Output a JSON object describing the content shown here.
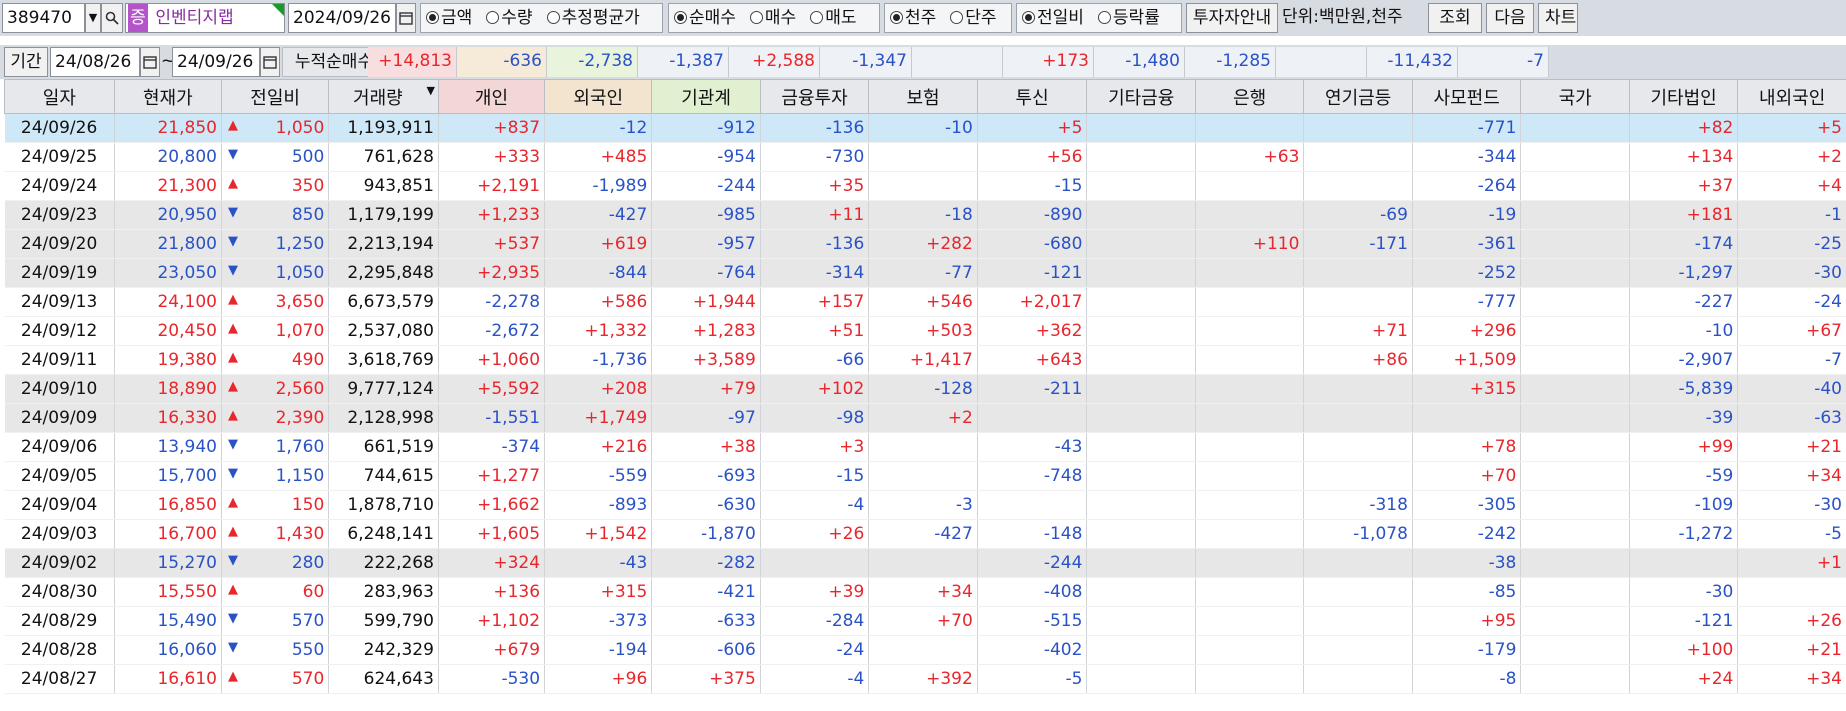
{
  "toolbar": {
    "code": "389470",
    "name_badge": "증",
    "name": "인벤티지랩",
    "date": "2024/09/26",
    "unit_type": [
      "금액",
      "수량",
      "추정평균가"
    ],
    "unit_type_selected": 0,
    "trade_type": [
      "순매수",
      "매수",
      "매도"
    ],
    "trade_type_selected": 0,
    "share_unit": [
      "천주",
      "단주"
    ],
    "share_unit_selected": 0,
    "compare": [
      "전일비",
      "등락률"
    ],
    "compare_selected": 0,
    "guide_button": "투자자안내",
    "unit_label": "단위:백만원,천주",
    "query_button": "조회",
    "next_button": "다음",
    "chart_button": "차트"
  },
  "period": {
    "label": "기간",
    "from": "24/08/26",
    "tilde": "~",
    "to": "24/09/26",
    "cum_label": "누적순매수",
    "totals": [
      "+14,813",
      "-636",
      "-2,738",
      "-1,387",
      "+2,588",
      "-1,347",
      "",
      "+173",
      "-1,480",
      "-1,285",
      "",
      "-11,432",
      "-7"
    ]
  },
  "headers": [
    "일자",
    "현재가",
    "전일비",
    "거래량",
    "개인",
    "외국인",
    "기관계",
    "금융투자",
    "보험",
    "투신",
    "기타금융",
    "은행",
    "연기금등",
    "사모펀드",
    "국가",
    "기타법인",
    "내외국인"
  ],
  "rows": [
    {
      "d": "24/09/26",
      "p": "21,850",
      "dir": "up",
      "ch": "1,050",
      "v": "1,193,911",
      "c": [
        "+837",
        "-12",
        "-912",
        "-136",
        "-10",
        "+5",
        "",
        "",
        "",
        "-771",
        "",
        "+82",
        "+5"
      ]
    },
    {
      "d": "24/09/25",
      "p": "20,800",
      "dir": "down",
      "ch": "500",
      "v": "761,628",
      "c": [
        "+333",
        "+485",
        "-954",
        "-730",
        "",
        "+56",
        "",
        "+63",
        "",
        "-344",
        "",
        "+134",
        "+2"
      ]
    },
    {
      "d": "24/09/24",
      "p": "21,300",
      "dir": "up",
      "ch": "350",
      "v": "943,851",
      "c": [
        "+2,191",
        "-1,989",
        "-244",
        "+35",
        "",
        "-15",
        "",
        "",
        "",
        "-264",
        "",
        "+37",
        "+4"
      ]
    },
    {
      "d": "24/09/23",
      "p": "20,950",
      "dir": "down",
      "ch": "850",
      "v": "1,179,199",
      "c": [
        "+1,233",
        "-427",
        "-985",
        "+11",
        "-18",
        "-890",
        "",
        "",
        "-69",
        "-19",
        "",
        "+181",
        "-1"
      ]
    },
    {
      "d": "24/09/20",
      "p": "21,800",
      "dir": "down",
      "ch": "1,250",
      "v": "2,213,194",
      "c": [
        "+537",
        "+619",
        "-957",
        "-136",
        "+282",
        "-680",
        "",
        "+110",
        "-171",
        "-361",
        "",
        "-174",
        "-25"
      ]
    },
    {
      "d": "24/09/19",
      "p": "23,050",
      "dir": "down",
      "ch": "1,050",
      "v": "2,295,848",
      "c": [
        "+2,935",
        "-844",
        "-764",
        "-314",
        "-77",
        "-121",
        "",
        "",
        "",
        "-252",
        "",
        "-1,297",
        "-30"
      ]
    },
    {
      "d": "24/09/13",
      "p": "24,100",
      "dir": "up",
      "ch": "3,650",
      "v": "6,673,579",
      "c": [
        "-2,278",
        "+586",
        "+1,944",
        "+157",
        "+546",
        "+2,017",
        "",
        "",
        "",
        "-777",
        "",
        "-227",
        "-24"
      ]
    },
    {
      "d": "24/09/12",
      "p": "20,450",
      "dir": "up",
      "ch": "1,070",
      "v": "2,537,080",
      "c": [
        "-2,672",
        "+1,332",
        "+1,283",
        "+51",
        "+503",
        "+362",
        "",
        "",
        "+71",
        "+296",
        "",
        "-10",
        "+67"
      ]
    },
    {
      "d": "24/09/11",
      "p": "19,380",
      "dir": "up",
      "ch": "490",
      "v": "3,618,769",
      "c": [
        "+1,060",
        "-1,736",
        "+3,589",
        "-66",
        "+1,417",
        "+643",
        "",
        "",
        "+86",
        "+1,509",
        "",
        "-2,907",
        "-7"
      ]
    },
    {
      "d": "24/09/10",
      "p": "18,890",
      "dir": "up",
      "ch": "2,560",
      "v": "9,777,124",
      "c": [
        "+5,592",
        "+208",
        "+79",
        "+102",
        "-128",
        "-211",
        "",
        "",
        "",
        "+315",
        "",
        "-5,839",
        "-40"
      ]
    },
    {
      "d": "24/09/09",
      "p": "16,330",
      "dir": "up",
      "ch": "2,390",
      "v": "2,128,998",
      "c": [
        "-1,551",
        "+1,749",
        "-97",
        "-98",
        "+2",
        "",
        "",
        "",
        "",
        "",
        "",
        "-39",
        "-63"
      ]
    },
    {
      "d": "24/09/06",
      "p": "13,940",
      "dir": "down",
      "ch": "1,760",
      "v": "661,519",
      "c": [
        "-374",
        "+216",
        "+38",
        "+3",
        "",
        "-43",
        "",
        "",
        "",
        "+78",
        "",
        "+99",
        "+21"
      ]
    },
    {
      "d": "24/09/05",
      "p": "15,700",
      "dir": "down",
      "ch": "1,150",
      "v": "744,615",
      "c": [
        "+1,277",
        "-559",
        "-693",
        "-15",
        "",
        "-748",
        "",
        "",
        "",
        "+70",
        "",
        "-59",
        "+34"
      ]
    },
    {
      "d": "24/09/04",
      "p": "16,850",
      "dir": "up",
      "ch": "150",
      "v": "1,878,710",
      "c": [
        "+1,662",
        "-893",
        "-630",
        "-4",
        "-3",
        "",
        "",
        "",
        "-318",
        "-305",
        "",
        "-109",
        "-30"
      ]
    },
    {
      "d": "24/09/03",
      "p": "16,700",
      "dir": "up",
      "ch": "1,430",
      "v": "6,248,141",
      "c": [
        "+1,605",
        "+1,542",
        "-1,870",
        "+26",
        "-427",
        "-148",
        "",
        "",
        "-1,078",
        "-242",
        "",
        "-1,272",
        "-5"
      ]
    },
    {
      "d": "24/09/02",
      "p": "15,270",
      "dir": "down",
      "ch": "280",
      "v": "222,268",
      "c": [
        "+324",
        "-43",
        "-282",
        "",
        "",
        "-244",
        "",
        "",
        "",
        "-38",
        "",
        "",
        "+1"
      ]
    },
    {
      "d": "24/08/30",
      "p": "15,550",
      "dir": "up",
      "ch": "60",
      "v": "283,963",
      "c": [
        "+136",
        "+315",
        "-421",
        "+39",
        "+34",
        "-408",
        "",
        "",
        "",
        "-85",
        "",
        "-30",
        ""
      ]
    },
    {
      "d": "24/08/29",
      "p": "15,490",
      "dir": "down",
      "ch": "570",
      "v": "599,790",
      "c": [
        "+1,102",
        "-373",
        "-633",
        "-284",
        "+70",
        "-515",
        "",
        "",
        "",
        "+95",
        "",
        "-121",
        "+26"
      ]
    },
    {
      "d": "24/08/28",
      "p": "16,060",
      "dir": "down",
      "ch": "550",
      "v": "242,329",
      "c": [
        "+679",
        "-194",
        "-606",
        "-24",
        "",
        "-402",
        "",
        "",
        "",
        "-179",
        "",
        "+100",
        "+21"
      ]
    },
    {
      "d": "24/08/27",
      "p": "16,610",
      "dir": "up",
      "ch": "570",
      "v": "624,643",
      "c": [
        "-530",
        "+96",
        "+375",
        "-4",
        "+392",
        "-5",
        "",
        "",
        "",
        "-8",
        "",
        "+24",
        "+34"
      ]
    }
  ],
  "colors": {
    "up": "#e8262c",
    "down": "#2a52c7",
    "selected_row": "#cfe8f7",
    "shaded_row": "#e7e7e7"
  },
  "icons": {
    "dropdown": "chevron-down-icon",
    "search": "search-icon",
    "calendar": "calendar-icon"
  }
}
